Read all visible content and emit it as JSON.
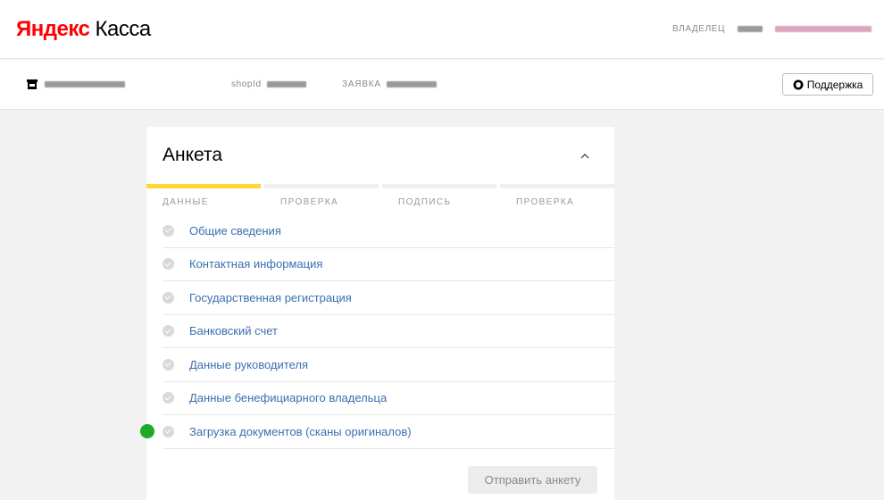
{
  "header": {
    "logo_brand": "Яндекс",
    "logo_product": "Касса",
    "owner_label": "ВЛАДЕЛЕЦ"
  },
  "subbar": {
    "shopid_label": "shopId",
    "zayavka_label": "ЗАЯВКА",
    "support_label": "Поддержка"
  },
  "form": {
    "title": "Анкета",
    "steps": [
      {
        "label": "ДАННЫЕ",
        "active": true
      },
      {
        "label": "ПРОВЕРКА",
        "active": false
      },
      {
        "label": "ПОДПИСЬ",
        "active": false
      },
      {
        "label": "ПРОВЕРКА",
        "active": false
      }
    ],
    "items": [
      {
        "label": "Общие сведения"
      },
      {
        "label": "Контактная информация"
      },
      {
        "label": "Государственная регистрация"
      },
      {
        "label": "Банковский счет"
      },
      {
        "label": "Данные руководителя"
      },
      {
        "label": "Данные бенефициарного владельца"
      },
      {
        "label": "Загрузка документов (сканы оригиналов)"
      }
    ],
    "submit_label": "Отправить анкету"
  },
  "colors": {
    "accent_step": "#ffd633",
    "link": "#3a6fb0",
    "status_dot": "#1eaa28",
    "logo_red": "#ff0000"
  }
}
